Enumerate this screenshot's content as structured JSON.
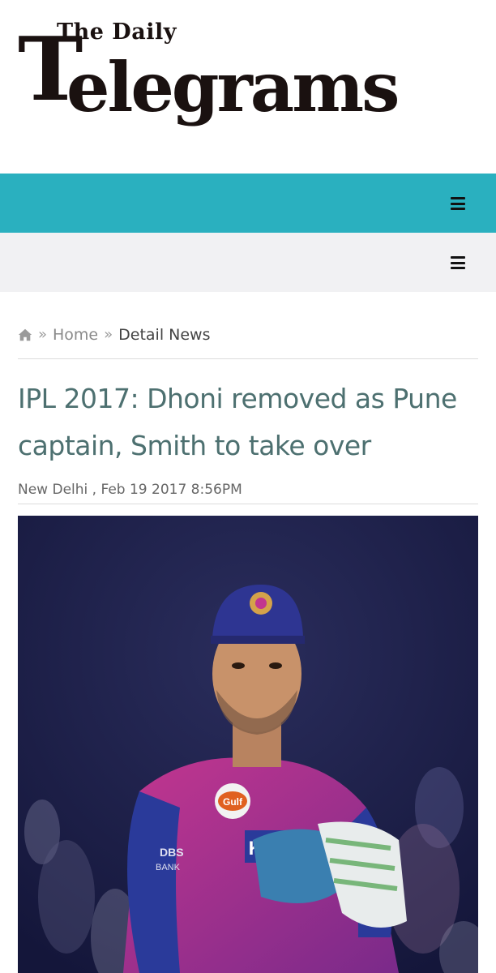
{
  "site": {
    "logo_top": "The Daily",
    "logo_initial": "T",
    "logo_rest": "elegrams"
  },
  "nav": {
    "primary_menu_icon": "hamburger-menu-icon",
    "secondary_menu_icon": "hamburger-menu-icon",
    "primary_color": "#2ab0bf",
    "secondary_color": "#f1f1f3"
  },
  "breadcrumb": {
    "home_icon": "home-icon",
    "separator": "»",
    "home_label": "Home",
    "current_label": "Detail News"
  },
  "article": {
    "title": "IPL 2017: Dhoni removed as Pune captain, Smith to take over",
    "byline": "New Delhi , Feb 19 2017 8:56PM",
    "image": {
      "kit_text_gulf": "Gulf",
      "kit_text_sponsor": "KEN",
      "kit_text_bank_top": "DBS",
      "kit_text_bank_bottom": "BANK"
    }
  }
}
